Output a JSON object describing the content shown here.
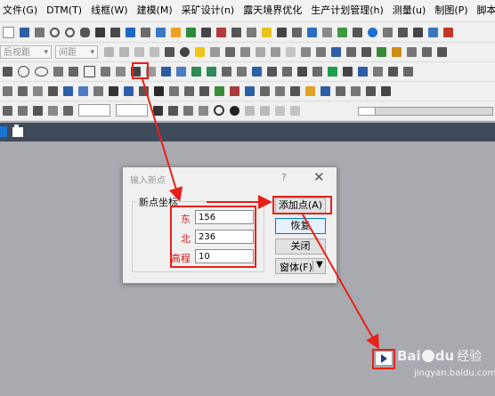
{
  "menubar": {
    "items": [
      "文件(G)",
      "DTM(T)",
      "线框(W)",
      "建模(M)",
      "采矿设计(n)",
      "露天境界优化",
      "生产计划管理(h)",
      "测量(u)",
      "制图(P)",
      "脚本"
    ]
  },
  "toolbar": {
    "view_combo": "后视距",
    "spacing_combo": "间距"
  },
  "dialog": {
    "title": "输入新点",
    "help": "?",
    "close": "✕",
    "group_label": "新点坐标",
    "fields": [
      {
        "label": "东",
        "value": "156"
      },
      {
        "label": "北",
        "value": "236"
      },
      {
        "label": "高程",
        "value": "10"
      }
    ],
    "buttons": {
      "add": "添加点(A)",
      "restore": "恢复",
      "close": "关闭",
      "window": "窗体(F)"
    }
  },
  "watermark": {
    "brand_a": "Bai",
    "brand_b": "du",
    "brand_cn": "经验",
    "url": "jingyan.baidu.com"
  },
  "colors": {
    "highlight": "#e8201a",
    "tabbar": "#3f4a5a",
    "canvas": "#a9aab0",
    "accent": "#0078d7"
  }
}
